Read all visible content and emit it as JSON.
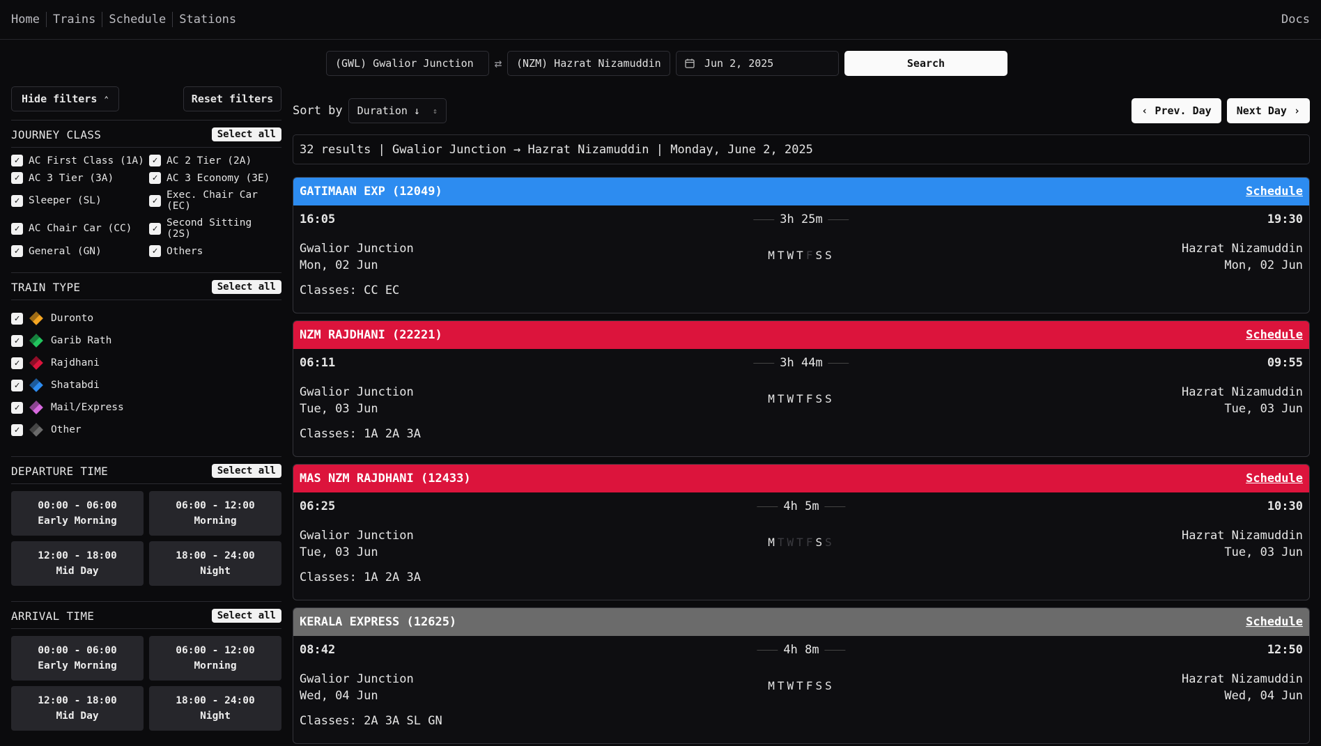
{
  "nav": {
    "items": [
      "Home",
      "Trains",
      "Schedule",
      "Stations"
    ],
    "docs": "Docs"
  },
  "search": {
    "from": "(GWL) Gwalior Junction",
    "to": "(NZM) Hazrat Nizamuddin",
    "date": "Jun 2, 2025",
    "button": "Search"
  },
  "filters": {
    "hide_label": "Hide filters",
    "reset_label": "Reset filters",
    "select_all": "Select all",
    "journey_class": {
      "title": "JOURNEY CLASS",
      "items": [
        "AC First Class (1A)",
        "AC 2 Tier (2A)",
        "AC 3 Tier (3A)",
        "AC 3 Economy (3E)",
        "Sleeper (SL)",
        "Exec. Chair Car (EC)",
        "AC Chair Car (CC)",
        "Second Sitting (2S)",
        "General (GN)",
        "Others"
      ]
    },
    "train_type": {
      "title": "TRAIN TYPE",
      "items": [
        {
          "label": "Duronto",
          "color": "#f5a623"
        },
        {
          "label": "Garib Rath",
          "color": "#22c55e"
        },
        {
          "label": "Rajdhani",
          "color": "#dc143c"
        },
        {
          "label": "Shatabdi",
          "color": "#2d8cf0"
        },
        {
          "label": "Mail/Express",
          "color": "#d86adf"
        },
        {
          "label": "Other",
          "color": "#6b6b6b"
        }
      ]
    },
    "departure": {
      "title": "DEPARTURE TIME",
      "slots": [
        {
          "range": "00:00 - 06:00",
          "name": "Early Morning"
        },
        {
          "range": "06:00 - 12:00",
          "name": "Morning"
        },
        {
          "range": "12:00 - 18:00",
          "name": "Mid Day"
        },
        {
          "range": "18:00 - 24:00",
          "name": "Night"
        }
      ]
    },
    "arrival": {
      "title": "ARRIVAL TIME",
      "slots": [
        {
          "range": "00:00 - 06:00",
          "name": "Early Morning"
        },
        {
          "range": "06:00 - 12:00",
          "name": "Morning"
        },
        {
          "range": "12:00 - 18:00",
          "name": "Mid Day"
        },
        {
          "range": "18:00 - 24:00",
          "name": "Night"
        }
      ]
    }
  },
  "sort": {
    "label": "Sort by",
    "value": "Duration ↓"
  },
  "day_nav": {
    "prev": "Prev. Day",
    "next": "Next Day"
  },
  "summary": "32 results | Gwalior Junction → Hazrat Nizamuddin | Monday, June 2, 2025",
  "schedule_label": "Schedule",
  "trains": [
    {
      "name": "GATIMAAN EXP (12049)",
      "color": "#2d8cf0",
      "dep": "16:05",
      "arr": "19:30",
      "duration": "3h 25m",
      "from": "Gwalior Junction",
      "from_date": "Mon, 02 Jun",
      "to": "Hazrat Nizamuddin",
      "to_date": "Mon, 02 Jun",
      "days": [
        1,
        1,
        1,
        1,
        0,
        1,
        1
      ],
      "classes": "Classes: CC EC"
    },
    {
      "name": "NZM RAJDHANI (22221)",
      "color": "#dc143c",
      "dep": "06:11",
      "arr": "09:55",
      "duration": "3h 44m",
      "from": "Gwalior Junction",
      "from_date": "Tue, 03 Jun",
      "to": "Hazrat Nizamuddin",
      "to_date": "Tue, 03 Jun",
      "days": [
        1,
        1,
        1,
        1,
        1,
        1,
        1
      ],
      "classes": "Classes: 1A 2A 3A"
    },
    {
      "name": "MAS NZM RAJDHANI (12433)",
      "color": "#dc143c",
      "dep": "06:25",
      "arr": "10:30",
      "duration": "4h 5m",
      "from": "Gwalior Junction",
      "from_date": "Tue, 03 Jun",
      "to": "Hazrat Nizamuddin",
      "to_date": "Tue, 03 Jun",
      "days": [
        1,
        0,
        0,
        0,
        0,
        1,
        0
      ],
      "classes": "Classes: 1A 2A 3A"
    },
    {
      "name": "KERALA EXPRESS (12625)",
      "color": "#6b6b6b",
      "dep": "08:42",
      "arr": "12:50",
      "duration": "4h 8m",
      "from": "Gwalior Junction",
      "from_date": "Wed, 04 Jun",
      "to": "Hazrat Nizamuddin",
      "to_date": "Wed, 04 Jun",
      "days": [
        1,
        1,
        1,
        1,
        1,
        1,
        1
      ],
      "classes": "Classes: 2A 3A SL GN"
    }
  ],
  "day_letters": [
    "M",
    "T",
    "W",
    "T",
    "F",
    "S",
    "S"
  ],
  "icons": {
    "swap": "swap-icon",
    "calendar": "calendar-icon",
    "chevron_up": "chevron-up-icon",
    "chevron_left": "chevron-left-icon",
    "chevron_right": "chevron-right-icon",
    "sort": "sort-updown-icon",
    "check": "check-icon"
  }
}
